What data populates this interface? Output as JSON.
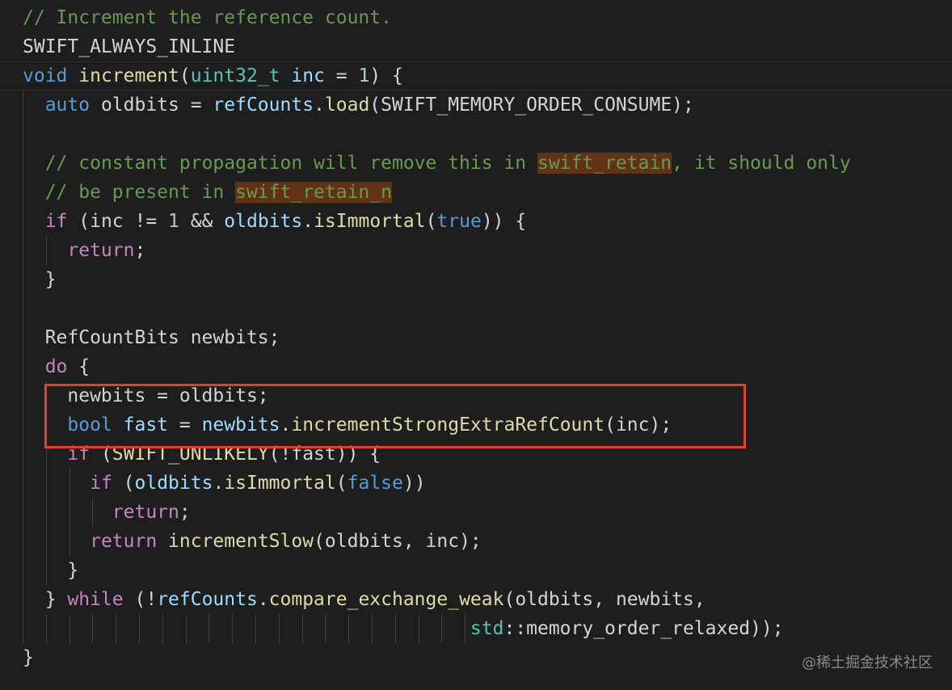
{
  "colors": {
    "background": "#1e1e1e",
    "comment": "#6a9955",
    "keyword": "#569cd6",
    "control": "#c586c0",
    "type": "#4ec9b0",
    "variable": "#9cdcfe",
    "function": "#dcdcaa",
    "number": "#b5cea8",
    "plain": "#d4d4d4",
    "search_highlight": "#613214",
    "annotation_box": "#e0402f"
  },
  "code": {
    "lines": [
      [
        {
          "t": "// Increment the reference count.",
          "c": "c"
        }
      ],
      [
        {
          "t": "SWIFT_ALWAYS_INLINE",
          "c": "p"
        }
      ],
      [
        {
          "t": "void",
          "c": "k"
        },
        {
          "t": " ",
          "c": "p"
        },
        {
          "t": "increment",
          "c": "f"
        },
        {
          "t": "(",
          "c": "p"
        },
        {
          "t": "uint32_t",
          "c": "t"
        },
        {
          "t": " ",
          "c": "p"
        },
        {
          "t": "inc",
          "c": "v"
        },
        {
          "t": " = ",
          "c": "p"
        },
        {
          "t": "1",
          "c": "n"
        },
        {
          "t": ") {",
          "c": "p"
        }
      ],
      [
        {
          "t": "  ",
          "c": "p"
        },
        {
          "t": "auto",
          "c": "k"
        },
        {
          "t": " oldbits = ",
          "c": "p"
        },
        {
          "t": "refCounts",
          "c": "v"
        },
        {
          "t": ".",
          "c": "p"
        },
        {
          "t": "load",
          "c": "f"
        },
        {
          "t": "(SWIFT_MEMORY_ORDER_CONSUME);",
          "c": "p"
        }
      ],
      [],
      [
        {
          "t": "  ",
          "c": "p"
        },
        {
          "t": "// constant propagation will remove this in ",
          "c": "c"
        },
        {
          "t": "swift_retain",
          "c": "c hl"
        },
        {
          "t": ", it should only",
          "c": "c"
        }
      ],
      [
        {
          "t": "  ",
          "c": "p"
        },
        {
          "t": "// be present in ",
          "c": "c"
        },
        {
          "t": "swift_retain_n",
          "c": "c hl"
        }
      ],
      [
        {
          "t": "  ",
          "c": "p"
        },
        {
          "t": "if",
          "c": "ctl"
        },
        {
          "t": " (inc != ",
          "c": "p"
        },
        {
          "t": "1",
          "c": "n"
        },
        {
          "t": " && ",
          "c": "p"
        },
        {
          "t": "oldbits",
          "c": "v"
        },
        {
          "t": ".",
          "c": "p"
        },
        {
          "t": "isImmortal",
          "c": "f"
        },
        {
          "t": "(",
          "c": "p"
        },
        {
          "t": "true",
          "c": "k"
        },
        {
          "t": ")) {",
          "c": "p"
        }
      ],
      [
        {
          "t": "    ",
          "c": "p"
        },
        {
          "t": "return",
          "c": "ctl"
        },
        {
          "t": ";",
          "c": "p"
        }
      ],
      [
        {
          "t": "  }",
          "c": "p"
        }
      ],
      [],
      [
        {
          "t": "  RefCountBits newbits;",
          "c": "p"
        }
      ],
      [
        {
          "t": "  ",
          "c": "p"
        },
        {
          "t": "do",
          "c": "ctl"
        },
        {
          "t": " {",
          "c": "p"
        }
      ],
      [
        {
          "t": "    newbits = oldbits;",
          "c": "p"
        }
      ],
      [
        {
          "t": "    ",
          "c": "p"
        },
        {
          "t": "bool",
          "c": "k"
        },
        {
          "t": " ",
          "c": "p"
        },
        {
          "t": "fast",
          "c": "v"
        },
        {
          "t": " = ",
          "c": "p"
        },
        {
          "t": "newbits",
          "c": "v"
        },
        {
          "t": ".",
          "c": "p"
        },
        {
          "t": "incrementStrongExtraRefCount",
          "c": "f"
        },
        {
          "t": "(inc);",
          "c": "p"
        }
      ],
      [
        {
          "t": "    ",
          "c": "p"
        },
        {
          "t": "if",
          "c": "ctl"
        },
        {
          "t": " (",
          "c": "p"
        },
        {
          "t": "SWIFT_UNLIKELY",
          "c": "f"
        },
        {
          "t": "(!fast)) {",
          "c": "p"
        }
      ],
      [
        {
          "t": "      ",
          "c": "p"
        },
        {
          "t": "if",
          "c": "ctl"
        },
        {
          "t": " (",
          "c": "p"
        },
        {
          "t": "oldbits",
          "c": "v"
        },
        {
          "t": ".",
          "c": "p"
        },
        {
          "t": "isImmortal",
          "c": "f"
        },
        {
          "t": "(",
          "c": "p"
        },
        {
          "t": "false",
          "c": "k"
        },
        {
          "t": "))",
          "c": "p"
        }
      ],
      [
        {
          "t": "        ",
          "c": "p"
        },
        {
          "t": "return",
          "c": "ctl"
        },
        {
          "t": ";",
          "c": "p"
        }
      ],
      [
        {
          "t": "      ",
          "c": "p"
        },
        {
          "t": "return",
          "c": "ctl"
        },
        {
          "t": " ",
          "c": "p"
        },
        {
          "t": "incrementSlow",
          "c": "f"
        },
        {
          "t": "(oldbits, inc);",
          "c": "p"
        }
      ],
      [
        {
          "t": "    }",
          "c": "p"
        }
      ],
      [
        {
          "t": "  } ",
          "c": "p"
        },
        {
          "t": "while",
          "c": "ctl"
        },
        {
          "t": " (!",
          "c": "p"
        },
        {
          "t": "refCounts",
          "c": "v"
        },
        {
          "t": ".",
          "c": "p"
        },
        {
          "t": "compare_exchange_weak",
          "c": "f"
        },
        {
          "t": "(oldbits, newbits,",
          "c": "p"
        }
      ],
      [
        {
          "t": "                                        ",
          "c": "p"
        },
        {
          "t": "std",
          "c": "t"
        },
        {
          "t": "::memory_order_relaxed));",
          "c": "p"
        }
      ],
      [
        {
          "t": "}",
          "c": "p"
        }
      ]
    ]
  },
  "watermark": "@稀土掘金技术社区"
}
